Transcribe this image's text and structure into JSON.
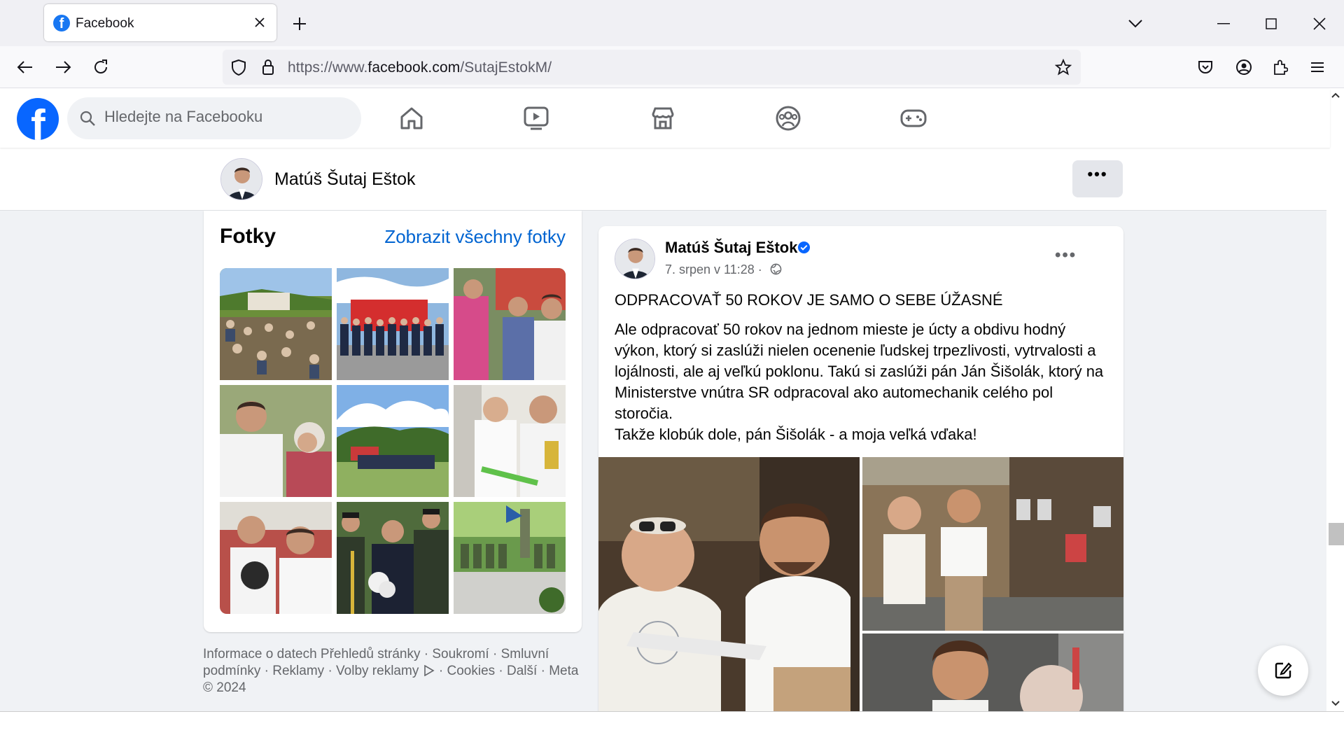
{
  "browser": {
    "tab_title": "Facebook",
    "url_prefix": "https://www.",
    "url_domain": "facebook.com",
    "url_path": "/SutajEstokM/"
  },
  "header": {
    "search_placeholder": "Hledejte na Facebooku",
    "nav_icons": [
      "home-icon",
      "watch-icon",
      "marketplace-icon",
      "groups-icon",
      "gaming-icon"
    ]
  },
  "profile": {
    "name": "Matúš Šutaj Eštok",
    "more_label": "•••"
  },
  "photos": {
    "heading": "Fotky",
    "see_all": "Zobrazit všechny fotky",
    "thumbnails": [
      "festival-crowd",
      "firefighters-group",
      "handshake-crowd",
      "greeting-elderly-woman",
      "field-gathering",
      "ribbon-cutting",
      "man-with-child",
      "honor-guard",
      "memorial-ceremony"
    ]
  },
  "footer": {
    "text": "Informace o datech Přehledů stránky · Soukromí · Smluvní podmínky · Reklamy · Volby reklamy",
    "text2": " · Cookies · Další · Meta © 2024"
  },
  "post": {
    "author": "Matúš Šutaj Eštok",
    "date": "7. srpen v 11:28 ·",
    "headline": "ODPRACOVAŤ 50 ROKOV JE SAMO O SEBE ÚŽASNÉ",
    "body": "Ale odpracovať 50 rokov na jednom mieste je úcty a obdivu hodný výkon, ktorý si zaslúži nielen ocenenie ľudskej trpezlivosti, vytrvalosti a lojálnosti, ale aj veľkú poklonu. Takú si zaslúži pán Ján Šišolák, ktorý na Ministerstve vnútra SR odpracoval ako automechanik celého pol storočia.",
    "body2": "Takže klobúk dole, pán Šišolák - a moja veľká vďaka!",
    "more_label": "•••"
  },
  "colors": {
    "brand": "#0866ff",
    "link": "#0064d1",
    "bg": "#f0f2f5"
  }
}
